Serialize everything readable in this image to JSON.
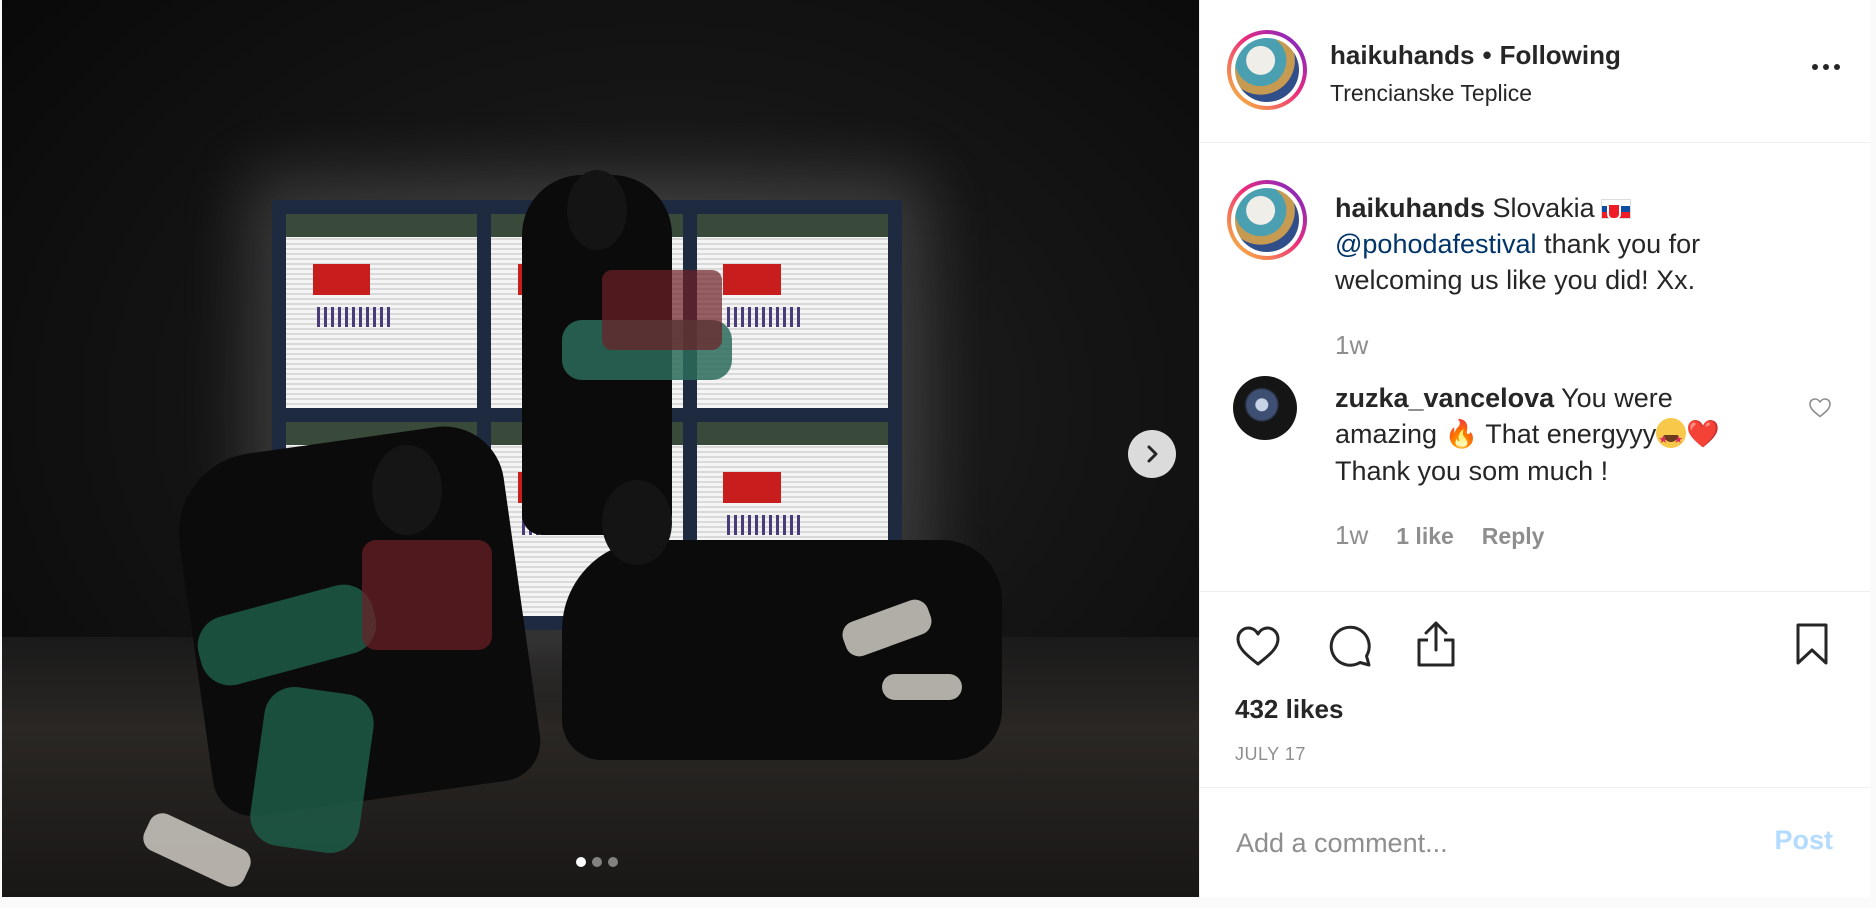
{
  "post": {
    "image_alt": "Three performers posing in front of a glowing LED screen on a dark stage",
    "carousel": {
      "total_slides": 3,
      "active_index": 0
    }
  },
  "header": {
    "username": "haikuhands",
    "separator": "•",
    "follow_status": "Following",
    "location": "Trencianske Teplice"
  },
  "caption": {
    "username": "haikuhands",
    "text_start": "Slovakia",
    "flag_emoji": "🇸🇰",
    "mention": "@pohodafestival",
    "text_end": "thank you for welcoming us like you did! Xx.",
    "time": "1w"
  },
  "comment": {
    "username": "zuzka_vancelova",
    "text_1": "You were amazing",
    "fire_emoji": "🔥",
    "text_2": "That energyyy",
    "starstruck_emoji": "🤩",
    "heart_emoji": "❤️",
    "text_3": "Thank you som much !",
    "time": "1w",
    "likes": "1 like",
    "reply": "Reply"
  },
  "actions": {
    "likes": "432 likes",
    "date": "JULY 17"
  },
  "add_comment": {
    "placeholder": "Add a comment...",
    "post_label": "Post"
  },
  "colors": {
    "text": "#262626",
    "muted": "#8e8e8e",
    "link": "#003569",
    "post_disabled": "#b3dbff"
  }
}
